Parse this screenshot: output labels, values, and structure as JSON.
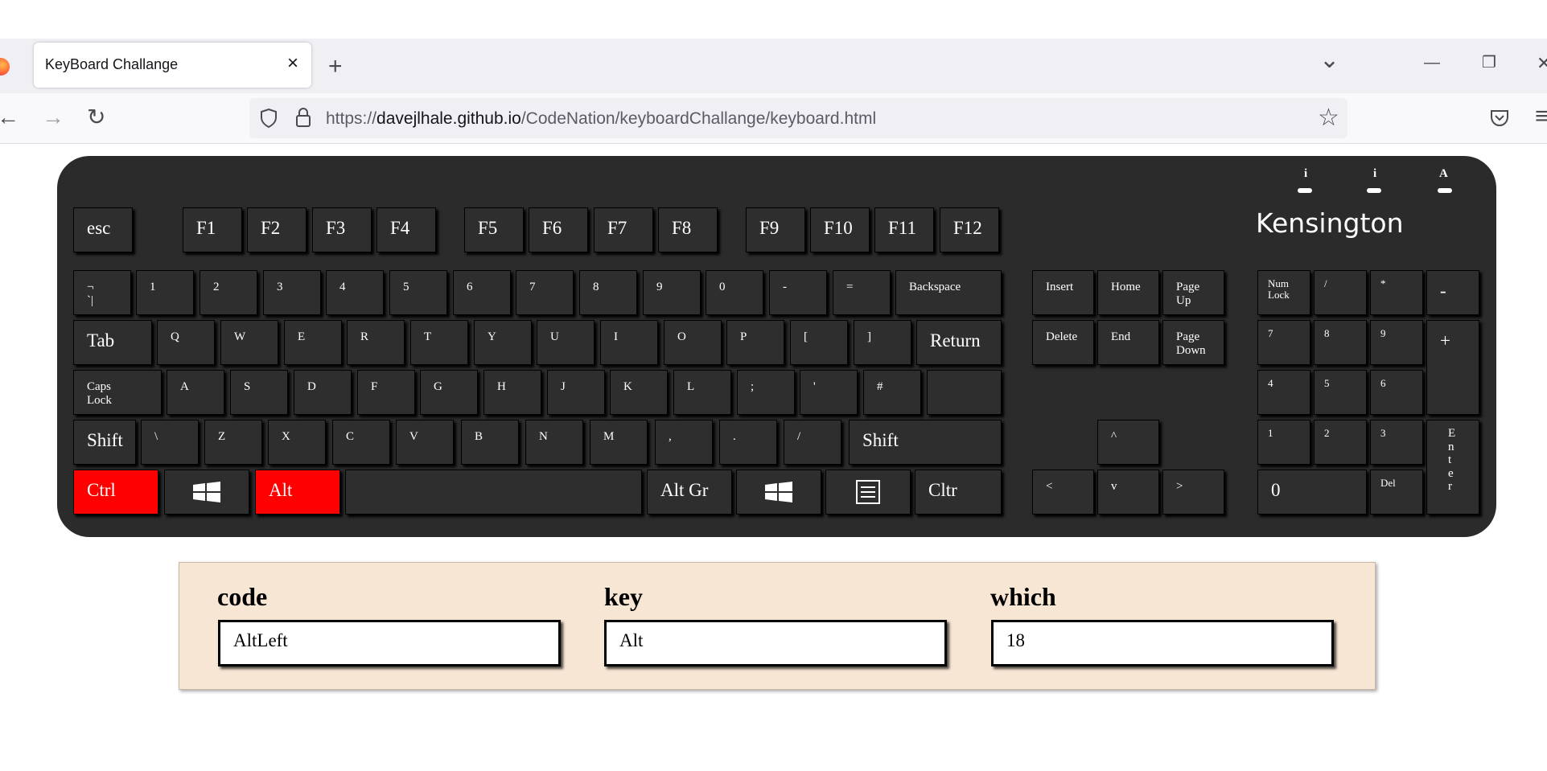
{
  "browser": {
    "tab_title": "KeyBoard Challange",
    "tab_close": "×",
    "new_tab": "+",
    "list_tabs": "⌄",
    "minimize": "—",
    "restore": "❐",
    "close_window": "✕",
    "back": "←",
    "forward": "→",
    "reload": "↻",
    "url_prefix": "https://",
    "url_host": "davejlhale.github.io",
    "url_path": "/CodeNation/keyboardChallange/keyboard.html",
    "bookmark": "☆",
    "menu": "≡"
  },
  "keyboard": {
    "brand": "Kensington",
    "leds": [
      "i",
      "i",
      "A"
    ],
    "keys": [
      {
        "id": "esc",
        "label": "esc"
      },
      {
        "id": "f1",
        "label": "F1"
      },
      {
        "id": "f2",
        "label": "F2"
      },
      {
        "id": "f3",
        "label": "F3"
      },
      {
        "id": "f4",
        "label": "F4"
      },
      {
        "id": "f5",
        "label": "F5"
      },
      {
        "id": "f6",
        "label": "F6"
      },
      {
        "id": "f7",
        "label": "F7"
      },
      {
        "id": "f8",
        "label": "F8"
      },
      {
        "id": "f9",
        "label": "F9"
      },
      {
        "id": "f10",
        "label": "F10"
      },
      {
        "id": "f11",
        "label": "F11"
      },
      {
        "id": "f12",
        "label": "F12"
      },
      {
        "id": "backquote",
        "label": "¬\n`|"
      },
      {
        "id": "digit1",
        "label": "1"
      },
      {
        "id": "digit2",
        "label": "2"
      },
      {
        "id": "digit3",
        "label": "3"
      },
      {
        "id": "digit4",
        "label": "4"
      },
      {
        "id": "digit5",
        "label": "5"
      },
      {
        "id": "digit6",
        "label": "6"
      },
      {
        "id": "digit7",
        "label": "7"
      },
      {
        "id": "digit8",
        "label": "8"
      },
      {
        "id": "digit9",
        "label": "9"
      },
      {
        "id": "digit0",
        "label": "0"
      },
      {
        "id": "minus",
        "label": "-"
      },
      {
        "id": "equal",
        "label": "="
      },
      {
        "id": "backspace",
        "label": "Backspace"
      },
      {
        "id": "tab",
        "label": "Tab"
      },
      {
        "id": "q",
        "label": "Q"
      },
      {
        "id": "w",
        "label": "W"
      },
      {
        "id": "e",
        "label": "E"
      },
      {
        "id": "r",
        "label": "R"
      },
      {
        "id": "t",
        "label": "T"
      },
      {
        "id": "y",
        "label": "Y"
      },
      {
        "id": "u",
        "label": "U"
      },
      {
        "id": "i",
        "label": "I"
      },
      {
        "id": "o",
        "label": "O"
      },
      {
        "id": "p",
        "label": "P"
      },
      {
        "id": "bracketleft",
        "label": "["
      },
      {
        "id": "bracketright",
        "label": "]"
      },
      {
        "id": "return",
        "label": "Return"
      },
      {
        "id": "capslock",
        "label": "Caps\nLock"
      },
      {
        "id": "a",
        "label": "A"
      },
      {
        "id": "s",
        "label": "S"
      },
      {
        "id": "d",
        "label": "D"
      },
      {
        "id": "f",
        "label": "F"
      },
      {
        "id": "g",
        "label": "G"
      },
      {
        "id": "h",
        "label": "H"
      },
      {
        "id": "j",
        "label": "J"
      },
      {
        "id": "k",
        "label": "K"
      },
      {
        "id": "l",
        "label": "L"
      },
      {
        "id": "semicolon",
        "label": ";"
      },
      {
        "id": "quote",
        "label": "'"
      },
      {
        "id": "hash",
        "label": "#"
      },
      {
        "id": "enter-lower",
        "label": ""
      },
      {
        "id": "shiftleft",
        "label": "Shift"
      },
      {
        "id": "backslash",
        "label": "\\"
      },
      {
        "id": "z",
        "label": "Z"
      },
      {
        "id": "x",
        "label": "X"
      },
      {
        "id": "c",
        "label": "C"
      },
      {
        "id": "v",
        "label": "V"
      },
      {
        "id": "b",
        "label": "B"
      },
      {
        "id": "n",
        "label": "N"
      },
      {
        "id": "m",
        "label": "M"
      },
      {
        "id": "comma",
        "label": ","
      },
      {
        "id": "period",
        "label": "."
      },
      {
        "id": "slash",
        "label": "/"
      },
      {
        "id": "shiftright",
        "label": "Shift"
      },
      {
        "id": "ctrlleft",
        "label": "Ctrl"
      },
      {
        "id": "metaleft",
        "label": ""
      },
      {
        "id": "altleft",
        "label": "Alt"
      },
      {
        "id": "space",
        "label": ""
      },
      {
        "id": "altgr",
        "label": "Alt Gr"
      },
      {
        "id": "metaright",
        "label": ""
      },
      {
        "id": "contextmenu",
        "label": ""
      },
      {
        "id": "ctrlright",
        "label": "Cltr"
      },
      {
        "id": "insert",
        "label": "Insert"
      },
      {
        "id": "home",
        "label": "Home"
      },
      {
        "id": "pageup",
        "label": "Page\nUp"
      },
      {
        "id": "delete",
        "label": "Delete"
      },
      {
        "id": "end",
        "label": "End"
      },
      {
        "id": "pagedown",
        "label": "Page\nDown"
      },
      {
        "id": "arrowup",
        "label": "^"
      },
      {
        "id": "arrowleft",
        "label": "<"
      },
      {
        "id": "arrowdown",
        "label": "v"
      },
      {
        "id": "arrowright",
        "label": ">"
      },
      {
        "id": "numlock",
        "label": "Num\nLock"
      },
      {
        "id": "numdivide",
        "label": "/"
      },
      {
        "id": "nummultiply",
        "label": "*"
      },
      {
        "id": "numsubtract",
        "label": "-"
      },
      {
        "id": "num7",
        "label": "7"
      },
      {
        "id": "num8",
        "label": "8"
      },
      {
        "id": "num9",
        "label": "9"
      },
      {
        "id": "numadd",
        "label": "+"
      },
      {
        "id": "num4",
        "label": "4"
      },
      {
        "id": "num5",
        "label": "5"
      },
      {
        "id": "num6",
        "label": "6"
      },
      {
        "id": "num1",
        "label": "1"
      },
      {
        "id": "num2",
        "label": "2"
      },
      {
        "id": "num3",
        "label": "3"
      },
      {
        "id": "numenter",
        "label": "E\nn\nt\ne\nr"
      },
      {
        "id": "num0",
        "label": "0"
      },
      {
        "id": "numdecimal",
        "label": "Del"
      }
    ],
    "highlight_color": "#ff0000",
    "pressed_keys": [
      "ctrlleft",
      "altleft"
    ]
  },
  "output": {
    "code_label": "code",
    "code_value": "AltLeft",
    "key_label": "key",
    "key_value": "Alt",
    "which_label": "which",
    "which_value": "18"
  }
}
